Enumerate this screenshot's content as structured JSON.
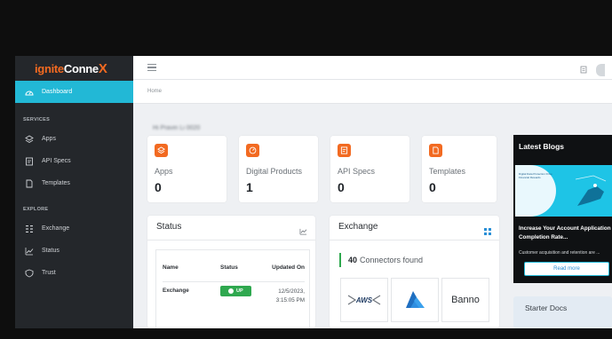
{
  "brand": {
    "part1": "ignite",
    "part2": "Conne",
    "part3": "X"
  },
  "sidebar": {
    "items": [
      {
        "label": "Dashboard",
        "icon": "dashboard-icon"
      }
    ],
    "services_label": "SERVICES",
    "services": [
      {
        "label": "Apps",
        "icon": "layers-icon"
      },
      {
        "label": "API Specs",
        "icon": "api-icon"
      },
      {
        "label": "Templates",
        "icon": "document-icon"
      }
    ],
    "explore_label": "EXPLORE",
    "explore": [
      {
        "label": "Exchange",
        "icon": "grid-icon"
      },
      {
        "label": "Status",
        "icon": "chart-icon"
      },
      {
        "label": "Trust",
        "icon": "shield-icon"
      }
    ]
  },
  "breadcrumb": {
    "home": "Home"
  },
  "greeting": "Hi Pravin Li 0020",
  "stats": [
    {
      "label": "Apps",
      "value": "0"
    },
    {
      "label": "Digital Products",
      "value": "1"
    },
    {
      "label": "API Specs",
      "value": "0"
    },
    {
      "label": "Templates",
      "value": "0"
    }
  ],
  "status_panel": {
    "title": "Status",
    "headers": {
      "name": "Name",
      "status": "Status",
      "updated": "Updated On"
    },
    "rows": [
      {
        "name": "Exchange",
        "status": "UP",
        "updated": "12/5/2023, 3:15:05 PM"
      }
    ]
  },
  "exchange_panel": {
    "title": "Exchange",
    "count": "40",
    "count_label": "Connectors found",
    "logos": [
      "AWS",
      "Azure",
      "Banno"
    ]
  },
  "blogs": {
    "title": "Latest Blogs",
    "post_title": "Increase Your Account Application Completion Rate...",
    "post_desc": "Customer acquisition and retention are ...",
    "button": "Read more",
    "image_text": "Digital Data Protection Drive Financial Rewards"
  },
  "starter_docs": "Starter Docs",
  "colors": {
    "accent": "#22b8d6",
    "brand_orange": "#f26a21",
    "status_green": "#2fa84f",
    "sidebar": "#24272b"
  }
}
